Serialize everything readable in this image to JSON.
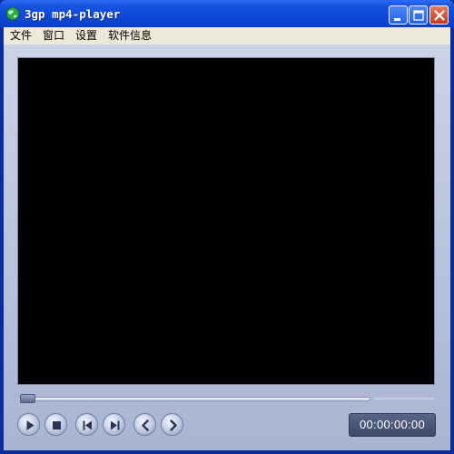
{
  "window": {
    "title": "3gp mp4-player",
    "icons": {
      "app": "globe-icon",
      "minimize": "minimize-icon",
      "maximize": "maximize-icon",
      "close": "close-icon"
    },
    "colors": {
      "titlebar": "#0d48d8",
      "close_button": "#c4391b",
      "frame": "#ece9d8"
    }
  },
  "menubar": {
    "items": [
      {
        "label": "文件"
      },
      {
        "label": "窗口"
      },
      {
        "label": "设置"
      },
      {
        "label": "软件信息"
      }
    ]
  },
  "player": {
    "video_background": "#000000",
    "seek_position": 0,
    "controls": [
      {
        "name": "play",
        "icon": "play-icon"
      },
      {
        "name": "stop",
        "icon": "stop-icon"
      },
      {
        "name": "previous",
        "icon": "skip-previous-icon"
      },
      {
        "name": "next",
        "icon": "skip-next-icon"
      },
      {
        "name": "rewind",
        "icon": "chevron-left-icon"
      },
      {
        "name": "forward",
        "icon": "chevron-right-icon"
      }
    ],
    "time_display": "00:00:00:00"
  }
}
